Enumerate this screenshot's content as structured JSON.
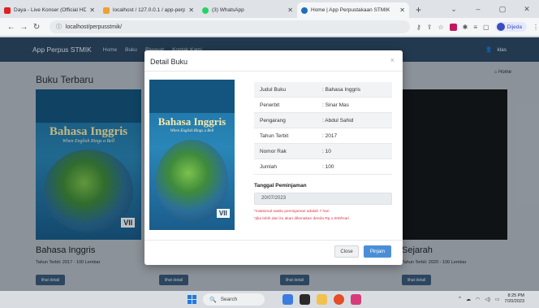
{
  "browser": {
    "tabs": [
      {
        "title": "Daya - Live Konser (Official HD)",
        "fav_color": "#e02020",
        "active": false
      },
      {
        "title": "localhost / 127.0.0.1 / app-perpu",
        "fav_color": "#f0a030",
        "active": false
      },
      {
        "title": "(3) WhatsApp",
        "fav_color": "#25d366",
        "active": false
      },
      {
        "title": "Home | App Perpustakaan STMIK",
        "fav_color": "#1f6fb8",
        "active": true
      }
    ],
    "new_tab": "+",
    "url": "localhost/perpusstmik/",
    "profile_name": "Dijeda",
    "window_controls": [
      "⌄",
      "–",
      "▢",
      "✕"
    ]
  },
  "navbar": {
    "brand": "App Perpus STMIK",
    "links": [
      "Home",
      "Buku",
      "Riwayat",
      "Kontak Kami"
    ],
    "user": "klas"
  },
  "page": {
    "section_title": "Buku Terbaru",
    "home_crumb": "Home",
    "cards": [
      {
        "title": "Bahasa Inggris",
        "meta": "Tahun Terbit: 2017 - 100 Lembar",
        "button": "lihat detail"
      },
      {
        "title": "",
        "meta": "",
        "button": "lihat detail"
      },
      {
        "title": "",
        "meta": "",
        "button": "lihat detail"
      },
      {
        "title": "Sejarah",
        "meta": "Tahun Terbit: 2020 - 100 Lembar",
        "button": "lihat detail"
      }
    ]
  },
  "book_cover": {
    "title": "Bahasa Inggris",
    "subtitle": "When English Rings a Bell",
    "grade": "VII"
  },
  "modal": {
    "title": "Detail Buku",
    "close_icon": "×",
    "details": [
      {
        "label": "Judul Buku",
        "value": ": Bahasa Inggris"
      },
      {
        "label": "Penerbit",
        "value": ": Sinar Mas"
      },
      {
        "label": "Pengarang",
        "value": ": Abdul Sahid"
      },
      {
        "label": "Tahun Terbit",
        "value": ": 2017"
      },
      {
        "label": "Nomor Rak",
        "value": ": 10"
      },
      {
        "label": "Jumlah",
        "value": ": 100"
      }
    ],
    "tanggal_label": "Tanggal Peminjaman",
    "tanggal_value": "20/07/2023",
    "notes": [
      "*maksimal waktu peminjaman adalah 7 hari",
      "*jika lebih dari itu akan dikenakan denda Rp.1.000/Hari"
    ],
    "close_button": "Close",
    "pinjam_button": "Pinjam"
  },
  "taskbar": {
    "search_placeholder": "Search",
    "time": "8:25 PM",
    "date": "7/20/2023"
  },
  "colors": {
    "navbar": "#2e4a66",
    "primary_button": "#4a8fd6",
    "danger_text": "#dc3545"
  }
}
